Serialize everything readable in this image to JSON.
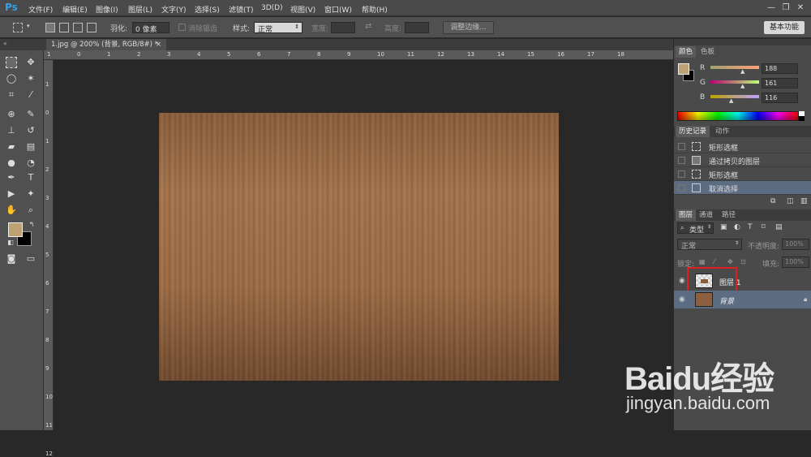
{
  "app": {
    "logo": "Ps"
  },
  "menu": [
    "文件(F)",
    "编辑(E)",
    "图像(I)",
    "图层(L)",
    "文字(Y)",
    "选择(S)",
    "滤镜(T)",
    "3D(D)",
    "视图(V)",
    "窗口(W)",
    "帮助(H)"
  ],
  "window_controls": {
    "minimize": "—",
    "restore": "❐",
    "close": "✕"
  },
  "options": {
    "feather_label": "羽化:",
    "feather_value": "0 像素",
    "antialias_label": "消除锯齿",
    "style_label": "样式:",
    "style_value": "正常",
    "width_label": "宽度:",
    "height_label": "高度:",
    "refine_button": "调整边缘...",
    "workspace_button": "基本功能"
  },
  "document_tab": {
    "title": "1.jpg @ 200% (背景, RGB/8#) *",
    "close": "×"
  },
  "ruler_top": [
    "1",
    "0",
    "1",
    "2",
    "3",
    "4",
    "5",
    "6",
    "7",
    "8",
    "9",
    "10",
    "11",
    "12",
    "13",
    "14",
    "15",
    "16",
    "17",
    "18"
  ],
  "ruler_left": [
    "1",
    "0",
    "1",
    "2",
    "3",
    "4",
    "5",
    "6",
    "7",
    "8",
    "9",
    "10",
    "11",
    "12"
  ],
  "color_panel": {
    "tabs": [
      "颜色",
      "色板"
    ],
    "r_label": "R",
    "g_label": "G",
    "b_label": "B",
    "r": "188",
    "g": "161",
    "b": "116",
    "foreground": "#bca174",
    "background": "#000000"
  },
  "history_panel": {
    "tabs": [
      "历史记录",
      "动作"
    ],
    "items": [
      {
        "label": "矩形选框"
      },
      {
        "label": "通过拷贝的图层"
      },
      {
        "label": "矩形选框"
      },
      {
        "label": "取消选择",
        "selected": true
      }
    ]
  },
  "layers_panel": {
    "tabs": [
      "图层",
      "通道",
      "路径"
    ],
    "filter_value": "类型",
    "blend_mode": "正常",
    "opacity_label": "不透明度:",
    "opacity_value": "100%",
    "lock_label": "锁定:",
    "fill_label": "填充:",
    "fill_value": "100%",
    "layers": [
      {
        "name": "图层 1",
        "selected": false
      },
      {
        "name": "背景",
        "selected": true
      }
    ]
  },
  "watermark": {
    "brand": "Baidu经验",
    "url": "jingyan.baidu.com"
  }
}
